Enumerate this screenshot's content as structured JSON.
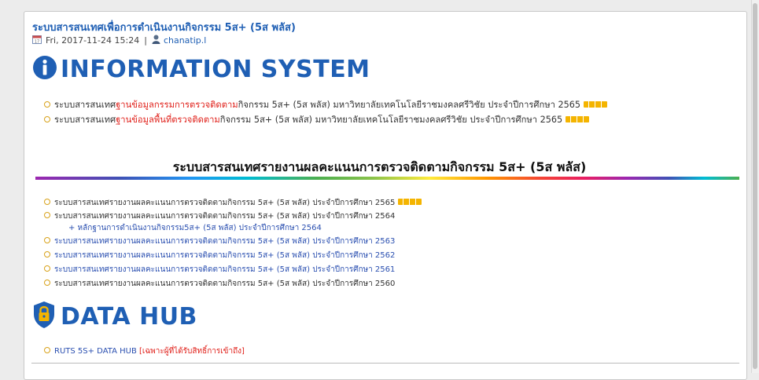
{
  "post": {
    "title": "ระบบสารสนเทศเพื่อการดำเนินงานกิจกรรม 5ส+ (5ส พลัส)",
    "date": "Fri, 2017-11-24 15:24",
    "separator": "|",
    "author": "chanatip.l"
  },
  "info_system": {
    "heading": "INFORMATION SYSTEM",
    "items": [
      {
        "prefix": "ระบบสารสนเทศ",
        "link": "ฐานข้อมูลกรรมการตรวจติดตาม",
        "suffix": "กิจกรรม 5ส+ (5ส พลัส) มหาวิทยาลัยเทคโนโลยีราชมงคลศรีวิชัย ประจำปีการศึกษา 2565"
      },
      {
        "prefix": "ระบบสารสนเทศ",
        "link": "ฐานข้อมูลพื้นที่ตรวจติดตาม",
        "suffix": "กิจกรรม 5ส+ (5ส พลัส) มหาวิทยาลัยเทคโนโลยีราชมงคลศรีวิชัย ประจำปีการศึกษา 2565"
      }
    ]
  },
  "report_section": {
    "heading": "ระบบสารสนเทศรายงานผลคะแนนการตรวจติดตามกิจกรรม 5ส+ (5ส พลัส)",
    "items": [
      "ระบบสารสนเทศรายงานผลคะแนนการตรวจติดตามกิจกรรม 5ส+ (5ส พลัส) ประจำปีการศึกษา 2565",
      "ระบบสารสนเทศรายงานผลคะแนนการตรวจติดตามกิจกรรม 5ส+ (5ส พลัส) ประจำปีการศึกษา 2564",
      "+ หลักฐานการดำเนินงานกิจกรรม5ส+ (5ส พลัส) ประจำปีการศึกษา 2564",
      "ระบบสารสนเทศรายงานผลคะแนนการตรวจติดตามกิจกรรม 5ส+ (5ส พลัส) ประจำปีการศึกษา 2563",
      "ระบบสารสนเทศรายงานผลคะแนนการตรวจติดตามกิจกรรม 5ส+ (5ส พลัส) ประจำปีการศึกษา 2562",
      "ระบบสารสนเทศรายงานผลคะแนนการตรวจติดตามกิจกรรม 5ส+ (5ส พลัส) ประจำปีการศึกษา 2561",
      "ระบบสารสนเทศรายงานผลคะแนนการตรวจติดตามกิจกรรม 5ส+ (5ส พลัส) ประจำปีการศึกษา 2560"
    ]
  },
  "data_hub": {
    "heading": "DATA HUB",
    "link": "RUTS 5S+ DATA HUB",
    "note": "[เฉพาะผู้ที่ได้รับสิทธิ์การเข้าถึง]"
  },
  "icons": {
    "calendar": "calendar-icon",
    "user": "user-icon",
    "info": "info-circle-icon",
    "lock": "shield-lock-icon",
    "new_badge": "new-badge-icon"
  },
  "colors": {
    "heading_blue": "#1f5fb4",
    "link_red": "#e0201a",
    "link_blue": "#2a4fb0",
    "text_dark": "#333333",
    "bullet_gold": "#d8a21a",
    "badge_gold": "#f4b400"
  }
}
